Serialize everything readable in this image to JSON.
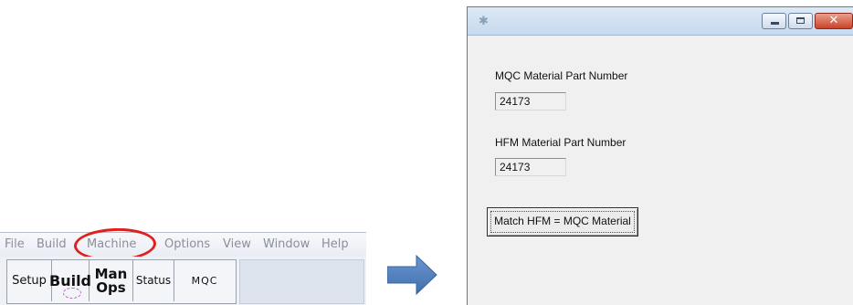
{
  "app": {
    "menu": [
      "File",
      "Build",
      "Machine",
      "Options",
      "View",
      "Window",
      "Help"
    ],
    "toolbar": {
      "setup": "Setup",
      "build": "Build",
      "man_ops_line1": "Man",
      "man_ops_line2": "Ops",
      "status": "Status",
      "mqc": "MQC"
    },
    "highlighted_menu": "Machine"
  },
  "dialog": {
    "mqc_label": "MQC Material Part Number",
    "mqc_value": "24173",
    "hfm_label": "HFM Material Part Number",
    "hfm_value": "24173",
    "match_button": "Match HFM = MQC Material",
    "close_glyph": "✕"
  },
  "colors": {
    "highlight_oval": "#e0201b",
    "arrow": "#4f81bd",
    "titlebar": "#c6d9ee",
    "close_button": "#c9442b"
  }
}
